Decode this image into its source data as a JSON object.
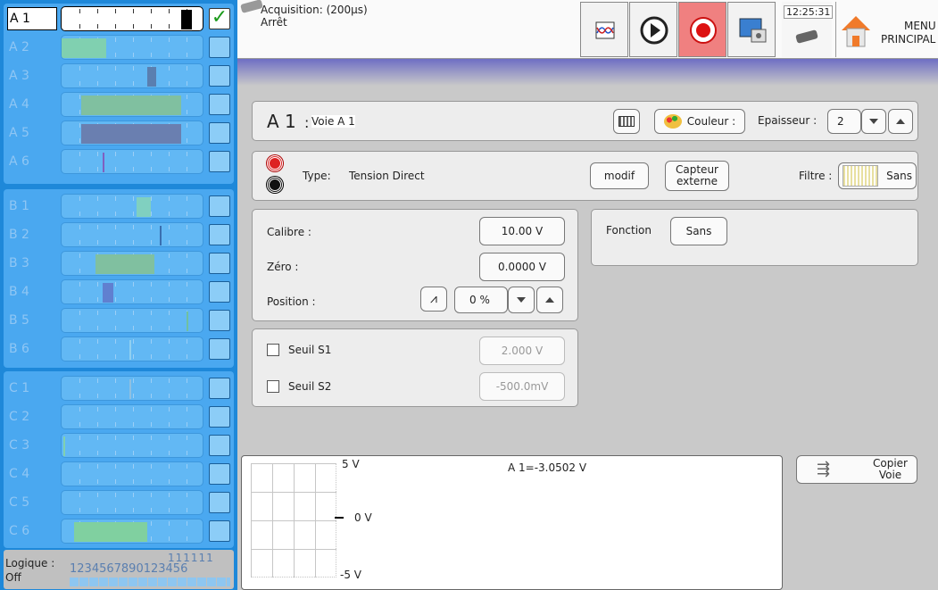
{
  "sidebar": {
    "group_a": [
      {
        "label": "A 1",
        "active": true
      },
      {
        "label": "A 2"
      },
      {
        "label": "A 3"
      },
      {
        "label": "A 4"
      },
      {
        "label": "A 5"
      },
      {
        "label": "A 6"
      }
    ],
    "group_b": [
      {
        "label": "B 1"
      },
      {
        "label": "B 2"
      },
      {
        "label": "B 3"
      },
      {
        "label": "B 4"
      },
      {
        "label": "B 5"
      },
      {
        "label": "B 6"
      }
    ],
    "group_c": [
      {
        "label": "C 1"
      },
      {
        "label": "C 2"
      },
      {
        "label": "C 3"
      },
      {
        "label": "C 4"
      },
      {
        "label": "C 5"
      },
      {
        "label": "C 6"
      }
    ],
    "logic_label": "Logique :",
    "logic_state": "Off",
    "logic_digits_top": "111111",
    "logic_digits_bottom": "1234567890123456"
  },
  "topbar": {
    "acq_title": "Acquisition: (200µs)",
    "acq_status": "Arrêt",
    "clock": "12:25:31",
    "menu_line1": "MENU",
    "menu_line2": "PRINCIPAL",
    "icons": [
      "waveform-icon",
      "play-icon",
      "record-icon",
      "screenshot-icon",
      "memory-chip-icon",
      "home-icon"
    ]
  },
  "channel": {
    "name": "A 1",
    "name_sep": ":",
    "title_value": "Voie A 1",
    "color_label": "Couleur :",
    "thickness_label": "Epaisseur :",
    "thickness_value": "2",
    "type_label": "Type:",
    "type_value": "Tension Direct",
    "modif_label": "modif",
    "sensor_label": "Capteur externe",
    "filter_label": "Filtre :",
    "filter_value": "Sans"
  },
  "settings": {
    "calibre_label": "Calibre :",
    "calibre_value": "10.00 V",
    "zero_label": "Zéro :",
    "zero_value": "0.0000 V",
    "position_label": "Position :",
    "position_value": "0 %",
    "fonction_label": "Fonction",
    "fonction_value": "Sans"
  },
  "thresholds": {
    "s1_label": "Seuil S1",
    "s1_value": "2.000 V",
    "s2_label": "Seuil S2",
    "s2_value": "-500.0mV"
  },
  "scope": {
    "top_label": "5 V",
    "mid_label": "0 V",
    "bottom_label": "-5 V",
    "readout": "A 1=-3.0502 V"
  },
  "copy_button": {
    "line1": "Copier",
    "line2": "Voie"
  },
  "colors": {
    "sidebar": "#1e88d9",
    "active_bg": "#ffffff",
    "record": "#f08080",
    "gradient_top": "#6e6ec4",
    "accent_green": "#1a9a1a"
  }
}
